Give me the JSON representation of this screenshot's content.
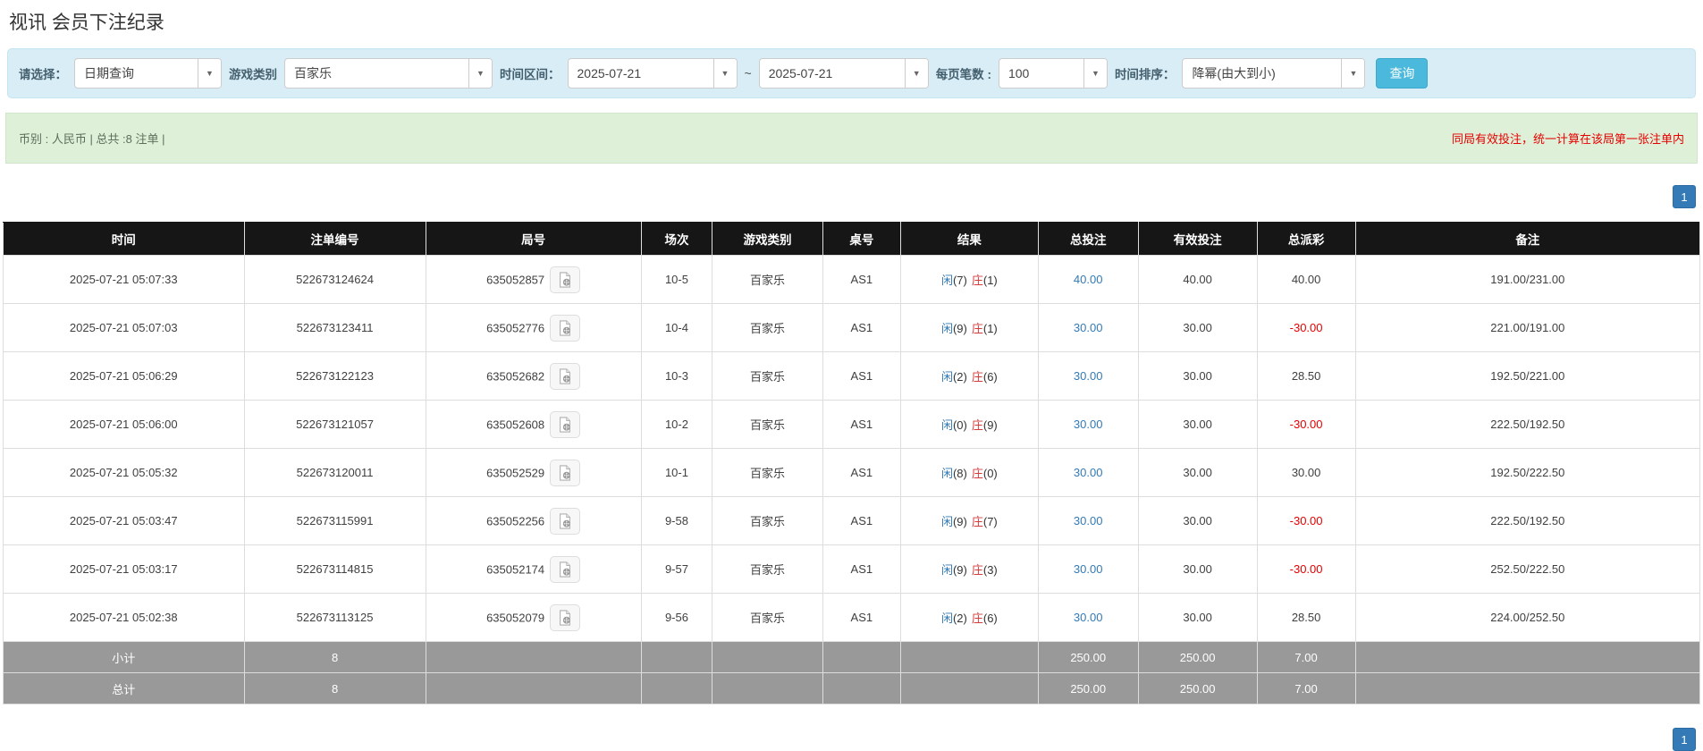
{
  "page": {
    "title": "视讯 会员下注纪录"
  },
  "filters": {
    "select_label": "请选择：",
    "query_type_value": "日期查询",
    "game_category_label": "游戏类别",
    "game_category_value": "百家乐",
    "date_range_label": "时间区间：",
    "date_from_value": "2025-07-21",
    "tilde": "~",
    "date_to_value": "2025-07-21",
    "page_size_label": "每页笔数 :",
    "page_size_value": "100",
    "sort_label": "时间排序：",
    "sort_value": "降幂(由大到小)",
    "search_button_label": "查询",
    "dropdown_arrow": "▼"
  },
  "summary": {
    "left_text": "币别 : 人民币 | 总共 :8 注单 |",
    "right_note": "同局有效投注，统一计算在该局第一张注单内"
  },
  "pagination": {
    "current_page": "1"
  },
  "table": {
    "headers": [
      "时间",
      "注单编号",
      "局号",
      "场次",
      "游戏类别",
      "桌号",
      "结果",
      "总投注",
      "有效投注",
      "总派彩",
      "备注"
    ],
    "rows": [
      {
        "time": "2025-07-21 05:07:33",
        "bet_no": "522673124624",
        "round_no": "635052857",
        "session": "10-5",
        "game": "百家乐",
        "table_no": "AS1",
        "result": {
          "p_label": "闲",
          "p_num": "(7)",
          "b_label": "庄",
          "b_num": "(1)"
        },
        "total_bet": "40.00",
        "valid_bet": "40.00",
        "payout": "40.00",
        "remark": "191.00/231.00"
      },
      {
        "time": "2025-07-21 05:07:03",
        "bet_no": "522673123411",
        "round_no": "635052776",
        "session": "10-4",
        "game": "百家乐",
        "table_no": "AS1",
        "result": {
          "p_label": "闲",
          "p_num": "(9)",
          "b_label": "庄",
          "b_num": "(1)"
        },
        "total_bet": "30.00",
        "valid_bet": "30.00",
        "payout": "-30.00",
        "remark": "221.00/191.00"
      },
      {
        "time": "2025-07-21 05:06:29",
        "bet_no": "522673122123",
        "round_no": "635052682",
        "session": "10-3",
        "game": "百家乐",
        "table_no": "AS1",
        "result": {
          "p_label": "闲",
          "p_num": "(2)",
          "b_label": "庄",
          "b_num": "(6)"
        },
        "total_bet": "30.00",
        "valid_bet": "30.00",
        "payout": "28.50",
        "remark": "192.50/221.00"
      },
      {
        "time": "2025-07-21 05:06:00",
        "bet_no": "522673121057",
        "round_no": "635052608",
        "session": "10-2",
        "game": "百家乐",
        "table_no": "AS1",
        "result": {
          "p_label": "闲",
          "p_num": "(0)",
          "b_label": "庄",
          "b_num": "(9)"
        },
        "total_bet": "30.00",
        "valid_bet": "30.00",
        "payout": "-30.00",
        "remark": "222.50/192.50"
      },
      {
        "time": "2025-07-21 05:05:32",
        "bet_no": "522673120011",
        "round_no": "635052529",
        "session": "10-1",
        "game": "百家乐",
        "table_no": "AS1",
        "result": {
          "p_label": "闲",
          "p_num": "(8)",
          "b_label": "庄",
          "b_num": "(0)"
        },
        "total_bet": "30.00",
        "valid_bet": "30.00",
        "payout": "30.00",
        "remark": "192.50/222.50"
      },
      {
        "time": "2025-07-21 05:03:47",
        "bet_no": "522673115991",
        "round_no": "635052256",
        "session": "9-58",
        "game": "百家乐",
        "table_no": "AS1",
        "result": {
          "p_label": "闲",
          "p_num": "(9)",
          "b_label": "庄",
          "b_num": "(7)"
        },
        "total_bet": "30.00",
        "valid_bet": "30.00",
        "payout": "-30.00",
        "remark": "222.50/192.50"
      },
      {
        "time": "2025-07-21 05:03:17",
        "bet_no": "522673114815",
        "round_no": "635052174",
        "session": "9-57",
        "game": "百家乐",
        "table_no": "AS1",
        "result": {
          "p_label": "闲",
          "p_num": "(9)",
          "b_label": "庄",
          "b_num": "(3)"
        },
        "total_bet": "30.00",
        "valid_bet": "30.00",
        "payout": "-30.00",
        "remark": "252.50/222.50"
      },
      {
        "time": "2025-07-21 05:02:38",
        "bet_no": "522673113125",
        "round_no": "635052079",
        "session": "9-56",
        "game": "百家乐",
        "table_no": "AS1",
        "result": {
          "p_label": "闲",
          "p_num": "(2)",
          "b_label": "庄",
          "b_num": "(6)"
        },
        "total_bet": "30.00",
        "valid_bet": "30.00",
        "payout": "28.50",
        "remark": "224.00/252.50"
      }
    ],
    "subtotal": {
      "label": "小计",
      "count": "8",
      "total_bet": "250.00",
      "valid_bet": "250.00",
      "payout": "7.00"
    },
    "total": {
      "label": "总计",
      "count": "8",
      "total_bet": "250.00",
      "valid_bet": "250.00",
      "payout": "7.00"
    }
  },
  "colors": {
    "filter_bar_bg": "#d9edf7",
    "search_button_bg": "#4ab9dc",
    "summary_bar_bg": "#dff0d8",
    "note_red": "#e60000",
    "header_bg": "#161616",
    "link_blue": "#337ab7",
    "player_blue": "#337ab7",
    "banker_red": "#d43b3b",
    "negative_red": "#e60000",
    "summary_row_bg": "#999999",
    "pagination_blue": "#337ab7"
  }
}
